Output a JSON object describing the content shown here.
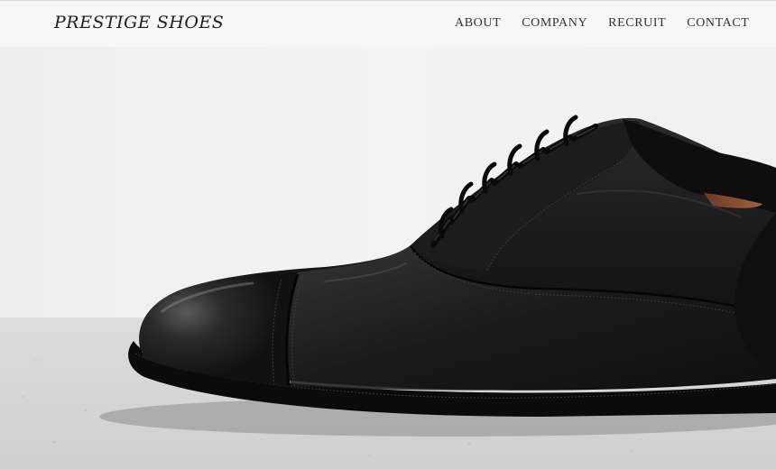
{
  "header": {
    "logo": "PRESTIGE SHOES",
    "nav": [
      {
        "label": "ABOUT"
      },
      {
        "label": "COMPANY"
      },
      {
        "label": "RECRUIT"
      },
      {
        "label": "CONTACT"
      }
    ]
  },
  "hero": {
    "image_subject": "black-cap-toe-oxford-shoe",
    "colors": {
      "wall": "#f1f1f1",
      "floor": "#d6d6d4",
      "leather": "#141414",
      "nav_background": "#f6f6f6"
    }
  }
}
